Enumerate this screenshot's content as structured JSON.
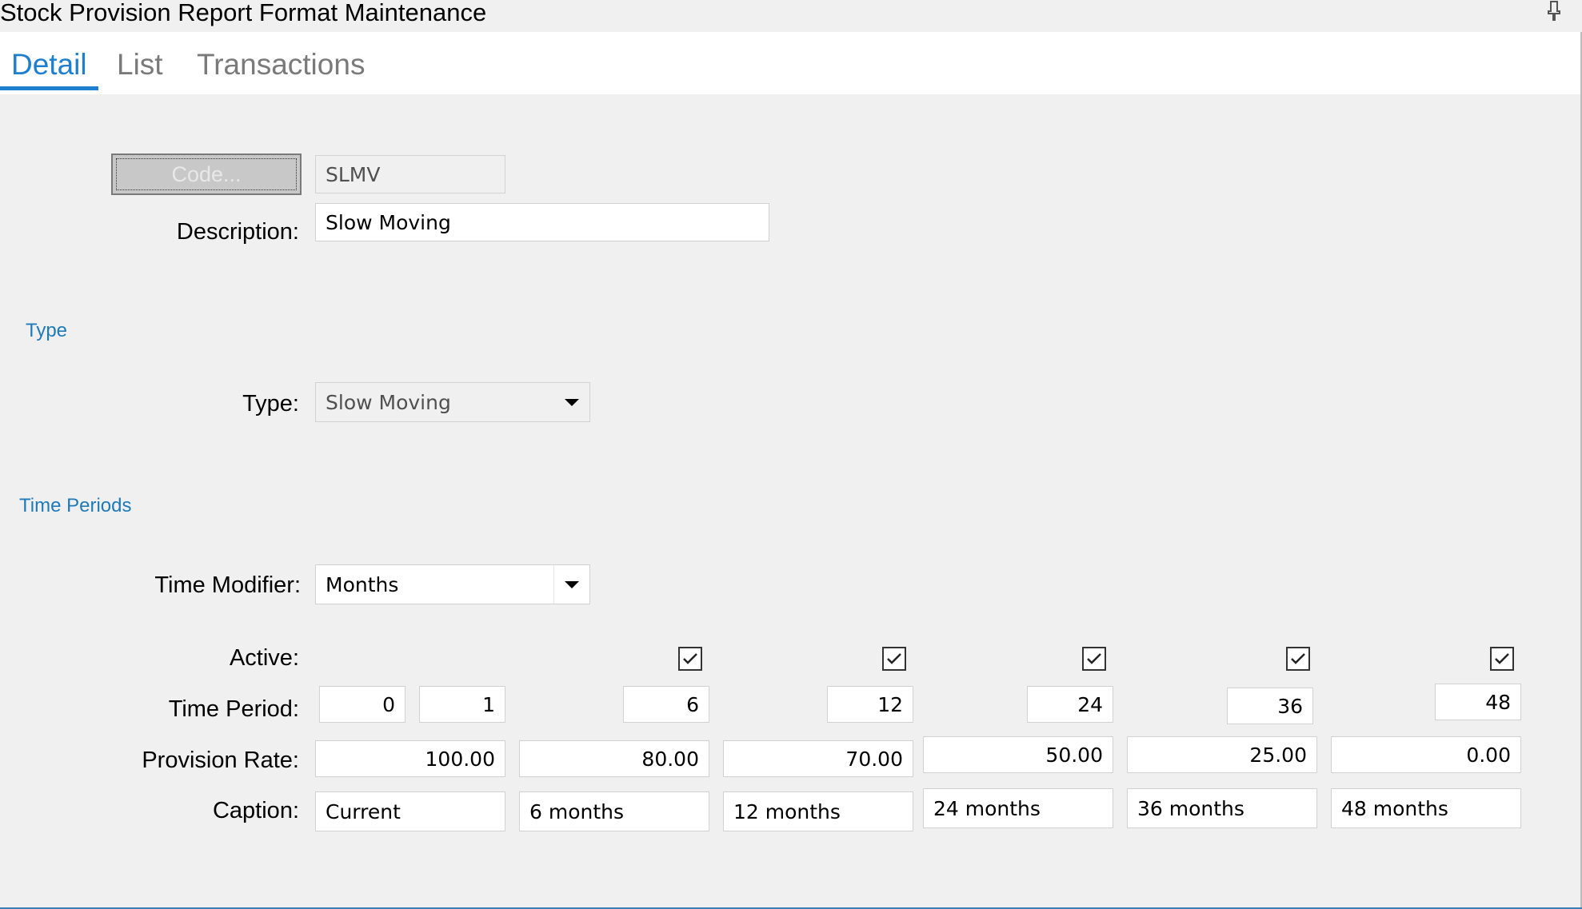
{
  "window": {
    "title": "Stock Provision Report Format Maintenance",
    "pin_icon": "pin-icon"
  },
  "tabs": [
    {
      "label": "Detail",
      "active": true
    },
    {
      "label": "List",
      "active": false
    },
    {
      "label": "Transactions",
      "active": false
    }
  ],
  "form": {
    "code_button": "Code...",
    "code_value": "SLMV",
    "description_label": "Description:",
    "description_value": "Slow Moving"
  },
  "type_section": {
    "heading": "Type",
    "type_label": "Type:",
    "type_value": "Slow Moving"
  },
  "time_section": {
    "heading": "Time Periods",
    "modifier_label": "Time Modifier:",
    "modifier_value": "Months",
    "active_label": "Active:",
    "period_label": "Time Period:",
    "rate_label": "Provision Rate:",
    "caption_label": "Caption:",
    "active": [
      true,
      true,
      true,
      true,
      true
    ],
    "periods": [
      "0",
      "1",
      "6",
      "12",
      "24",
      "36",
      "48"
    ],
    "rates": [
      "100.00",
      "80.00",
      "70.00",
      "50.00",
      "25.00",
      "0.00"
    ],
    "captions": [
      "Current",
      "6 months",
      "12 months",
      "24 months",
      "36 months",
      "48 months"
    ]
  },
  "colors": {
    "accent": "#1e7fce",
    "section_heading": "#1e7ab8",
    "background": "#f0f0f0"
  }
}
